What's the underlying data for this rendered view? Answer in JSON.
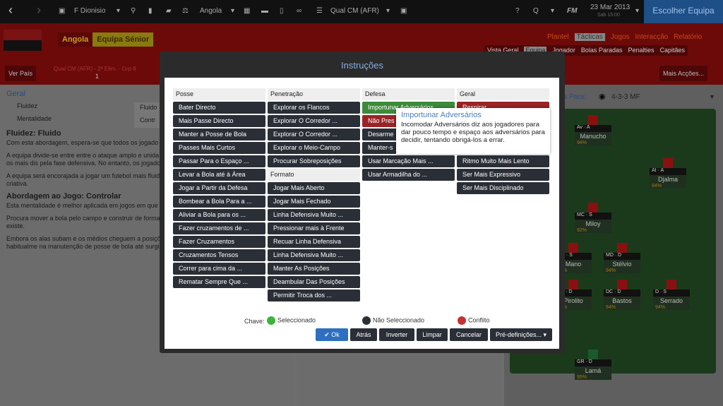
{
  "topbar": {
    "club": "F Dionisio",
    "nation": "Angola",
    "competition": "Qual CM (AFR)",
    "brand": "FM",
    "date": "23 Mar 2013",
    "time": "Sab 15:00",
    "choose_team": "Escolher Equipa"
  },
  "header": {
    "team": "Angola",
    "squad": "Equipa Sénior",
    "nav": [
      "Plantel",
      "Tácticas",
      "Jogos",
      "Interacção",
      "Relatório"
    ],
    "subnav": [
      "Vista Geral",
      "Equipa",
      "Jogador",
      "Bolas Paradas",
      "Penalties",
      "Capitães"
    ],
    "view_country": "Ver País",
    "competition": "Qual CM (AFR) - 2ª Elim. - Grp 8",
    "position": "1",
    "more_actions": "Mais Acções..."
  },
  "left": {
    "title": "Geral",
    "rows": [
      {
        "label": "Fluidez",
        "value": "Fluido"
      },
      {
        "label": "Mentalidade",
        "value": "Contr"
      }
    ],
    "h1": "Fluidez: Fluido",
    "p1": "Com esta abordagem, espera-se que todos os jogado na filosofia Equilibrada.",
    "p2": "A equipa divide-se entre entre o ataque amplo e unida criativos responsáveis pela fase ofensiva e os mais dis pela fase defensiva. No entanto, os jogadores de cada sempre que têm oportunidade.",
    "p3": "A equipa será encorajada a jogar um futebol mais fluid comportamentos de maior liberdade criativa.",
    "h2": "Abordagem ao Jogo: Controlar",
    "p4": "Esta mentalidade é melhor aplicada em jogos em que contra-ataque do adversário.",
    "p5": "Procura mover a bola pelo campo e construir de forma campo para encontrar o espaço quando ele existe.",
    "p6": "Embora os alas subam e os médios cheguem a posiçõ durante situação relativamente sem risco e habitualme na manutenção de posse de bola até surgirem oportu"
  },
  "right": {
    "label": "ipa Para:",
    "formation": "4-3-3 MF",
    "players": [
      {
        "name": "Manucho",
        "pos": "Av",
        "role": "A",
        "pct": "94%"
      },
      {
        "name": "Djalma",
        "pos": "AI",
        "role": "A",
        "pct": "94%"
      },
      {
        "name": "Miloy",
        "pos": "MC",
        "role": "S",
        "pct": "92%"
      },
      {
        "name": "Mano",
        "pos": "MD",
        "role": "S",
        "pct": "94%"
      },
      {
        "name": "Stélvio",
        "pos": "MD",
        "role": "D",
        "pct": "94%"
      },
      {
        "name": "Pirolito",
        "pos": "DC",
        "role": "D",
        "pct": "94%"
      },
      {
        "name": "Bastos",
        "pos": "DC",
        "role": "D",
        "pct": "94%"
      },
      {
        "name": "Serrado",
        "pos": "D",
        "role": "S",
        "pct": "94%"
      },
      {
        "name": "Lamá",
        "pos": "GR",
        "role": "D",
        "pct": "95%"
      }
    ]
  },
  "modal": {
    "title": "Instruções",
    "columns": [
      {
        "header": "Posse",
        "items": [
          "Bater Directo",
          "Mais Passe Directo",
          "Manter a Posse de Bola",
          "Passes Mais Curtos",
          "Passar Para o Espaço ...",
          "Levar a Bola até à Área",
          "Jogar a Partir da Defesa",
          "Bombear a Bola Para a ...",
          "Aliviar a Bola para os ...",
          "Fazer cruzamentos de ...",
          "Fazer Cruzamentos",
          "Cruzamentos Tensos",
          "Correr para cima da ...",
          "Rematar Sempre Que ..."
        ]
      },
      {
        "header": "Penetração",
        "items": [
          "Explorar os Flancos",
          "Explorar O Corredor ...",
          "Explorar O Corredor ...",
          "Explorar o Meio-Campo",
          "Procurar Sobreposições"
        ],
        "header2": "Formato",
        "items2": [
          "Jogar Mais Aberto",
          "Jogar Mais Fechado",
          "Linha Defensiva Muito ...",
          "Pressionar mais à Frente",
          "Recuar Linha Defensiva",
          "Linha Defensiva Muito ...",
          "Manter As Posições",
          "Deambular Das Posições",
          "Permitir Troca dos ..."
        ]
      },
      {
        "header": "Defesa",
        "items": [
          "Importunar Adversários",
          "Não Pres",
          "Desarme",
          "Manter-s",
          "Usar Marcação Mais ...",
          "Usar Armadilha do ..."
        ]
      },
      {
        "header": "Geral",
        "items": [
          "Respirar",
          "",
          "",
          "",
          "Ritmo Muito Mais Lento",
          "Ser Mais Expressivo",
          "Ser Mais Disciplinado"
        ]
      }
    ],
    "tooltip": {
      "title": "Importunar Adversários",
      "text": "Incomodar Adversários diz aos jogadores para dar pouco tempo e espaço aos adversários para decidir, tentando obrigá-los a errar."
    },
    "key": {
      "label": "Chave:",
      "selected": "Seleccionado",
      "not_selected": "Não Seleccionado",
      "conflict": "Conflito"
    },
    "buttons": {
      "ok": "Ok",
      "back": "Atrás",
      "invert": "Inverter",
      "clear": "Limpar",
      "cancel": "Cancelar",
      "presets": "Pré-definições..."
    },
    "colors": {
      "selected": "#3d8a3a",
      "not_selected": "#2a2e36",
      "conflict": "#9a2424",
      "ok": "#2f6fbf"
    }
  }
}
